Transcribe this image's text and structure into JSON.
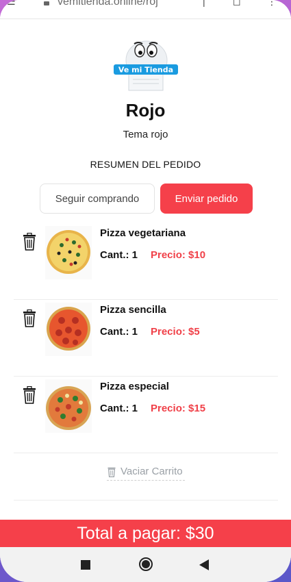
{
  "browser": {
    "url": "vemitienda.online/roj"
  },
  "logo": {
    "text": "Ve mi Tienda"
  },
  "store": {
    "title": "Rojo",
    "subtitle": "Tema rojo"
  },
  "order": {
    "summary_title": "RESUMEN DEL PEDIDO",
    "keep_shopping_label": "Seguir comprando",
    "send_order_label": "Enviar pedido"
  },
  "items": [
    {
      "name": "Pizza vegetariana",
      "qty": "Cant.: 1",
      "price": "Precio: $10"
    },
    {
      "name": "Pizza sencilla",
      "qty": "Cant.: 1",
      "price": "Precio: $5"
    },
    {
      "name": "Pizza especial",
      "qty": "Cant.: 1",
      "price": "Precio: $15"
    }
  ],
  "cart": {
    "empty_label": "Vaciar Carrito"
  },
  "total": {
    "label": "Total a pagar: $30"
  },
  "colors": {
    "accent": "#f5404a",
    "price": "#f04048"
  },
  "icons": [
    "lock-icon",
    "trash-icon",
    "square-nav-icon",
    "circle-nav-icon",
    "back-nav-icon"
  ]
}
